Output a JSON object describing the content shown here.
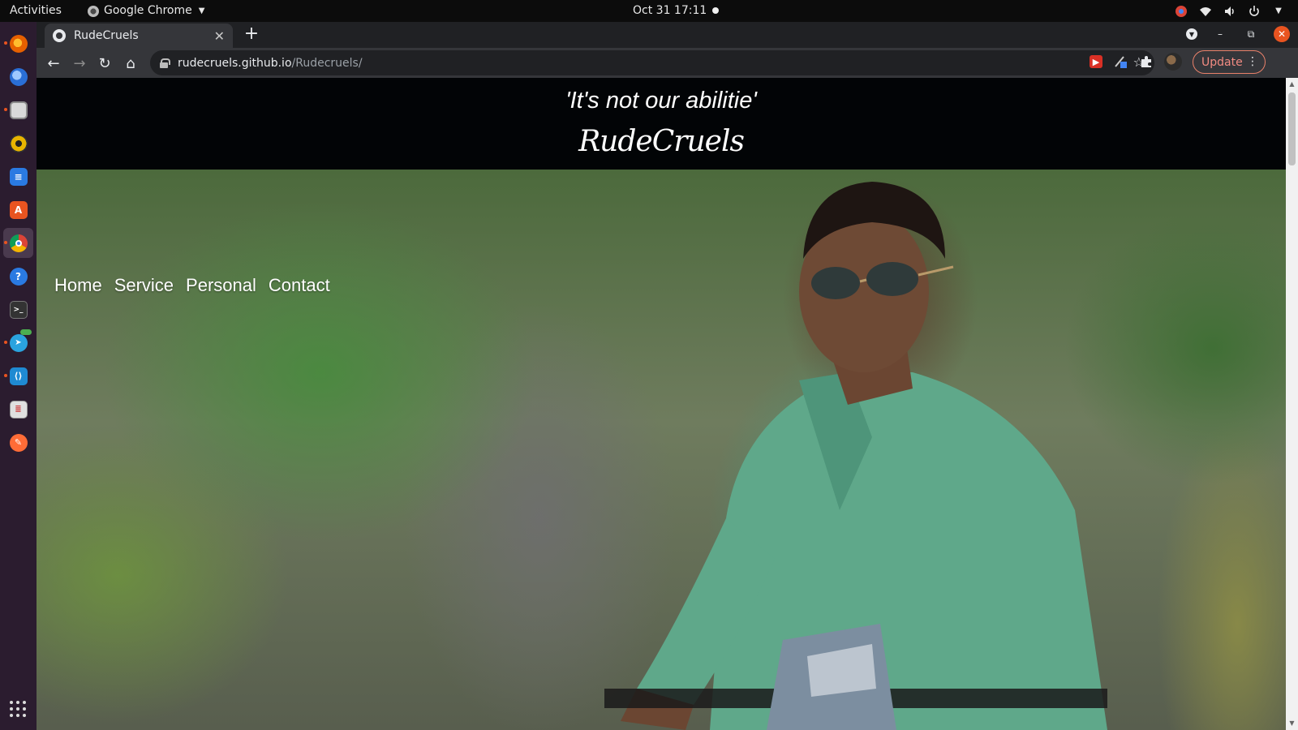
{
  "topbar": {
    "activities": "Activities",
    "app_name": "Google Chrome",
    "clock": "Oct 31  17:11"
  },
  "dock": {
    "items": [
      {
        "name": "firefox-icon",
        "color": "#e66000"
      },
      {
        "name": "thunderbird-icon",
        "color": "#2a6fd6"
      },
      {
        "name": "files-icon",
        "color": "#d9d9d9"
      },
      {
        "name": "rhythmbox-icon",
        "color": "#e8b400"
      },
      {
        "name": "libreoffice-writer-icon",
        "color": "#2a7ae2"
      },
      {
        "name": "software-center-icon",
        "color": "#e95420"
      },
      {
        "name": "chrome-icon",
        "color": "#4285f4"
      },
      {
        "name": "help-icon",
        "color": "#2a7ae2"
      },
      {
        "name": "terminal-icon",
        "color": "#333333"
      },
      {
        "name": "telegram-icon",
        "color": "#2aa3df"
      },
      {
        "name": "vscode-icon",
        "color": "#1f8ad2"
      },
      {
        "name": "text-editor-icon",
        "color": "#e0e0e0"
      },
      {
        "name": "postman-icon",
        "color": "#ff6c37"
      }
    ]
  },
  "browser": {
    "tab_title": "RudeCruels",
    "url_host": "rudecruels.github.io",
    "url_path": "/Rudecruels/",
    "update_label": "Update"
  },
  "page": {
    "tagline": "'It's not our abilitie'",
    "logo": "RudeCruels",
    "nav": [
      "Home",
      "Service",
      "Personal",
      "Contact"
    ]
  },
  "colors": {
    "accent": "#e95420",
    "dock_bg": "#2b1c2f",
    "chrome_dark": "#202124"
  }
}
